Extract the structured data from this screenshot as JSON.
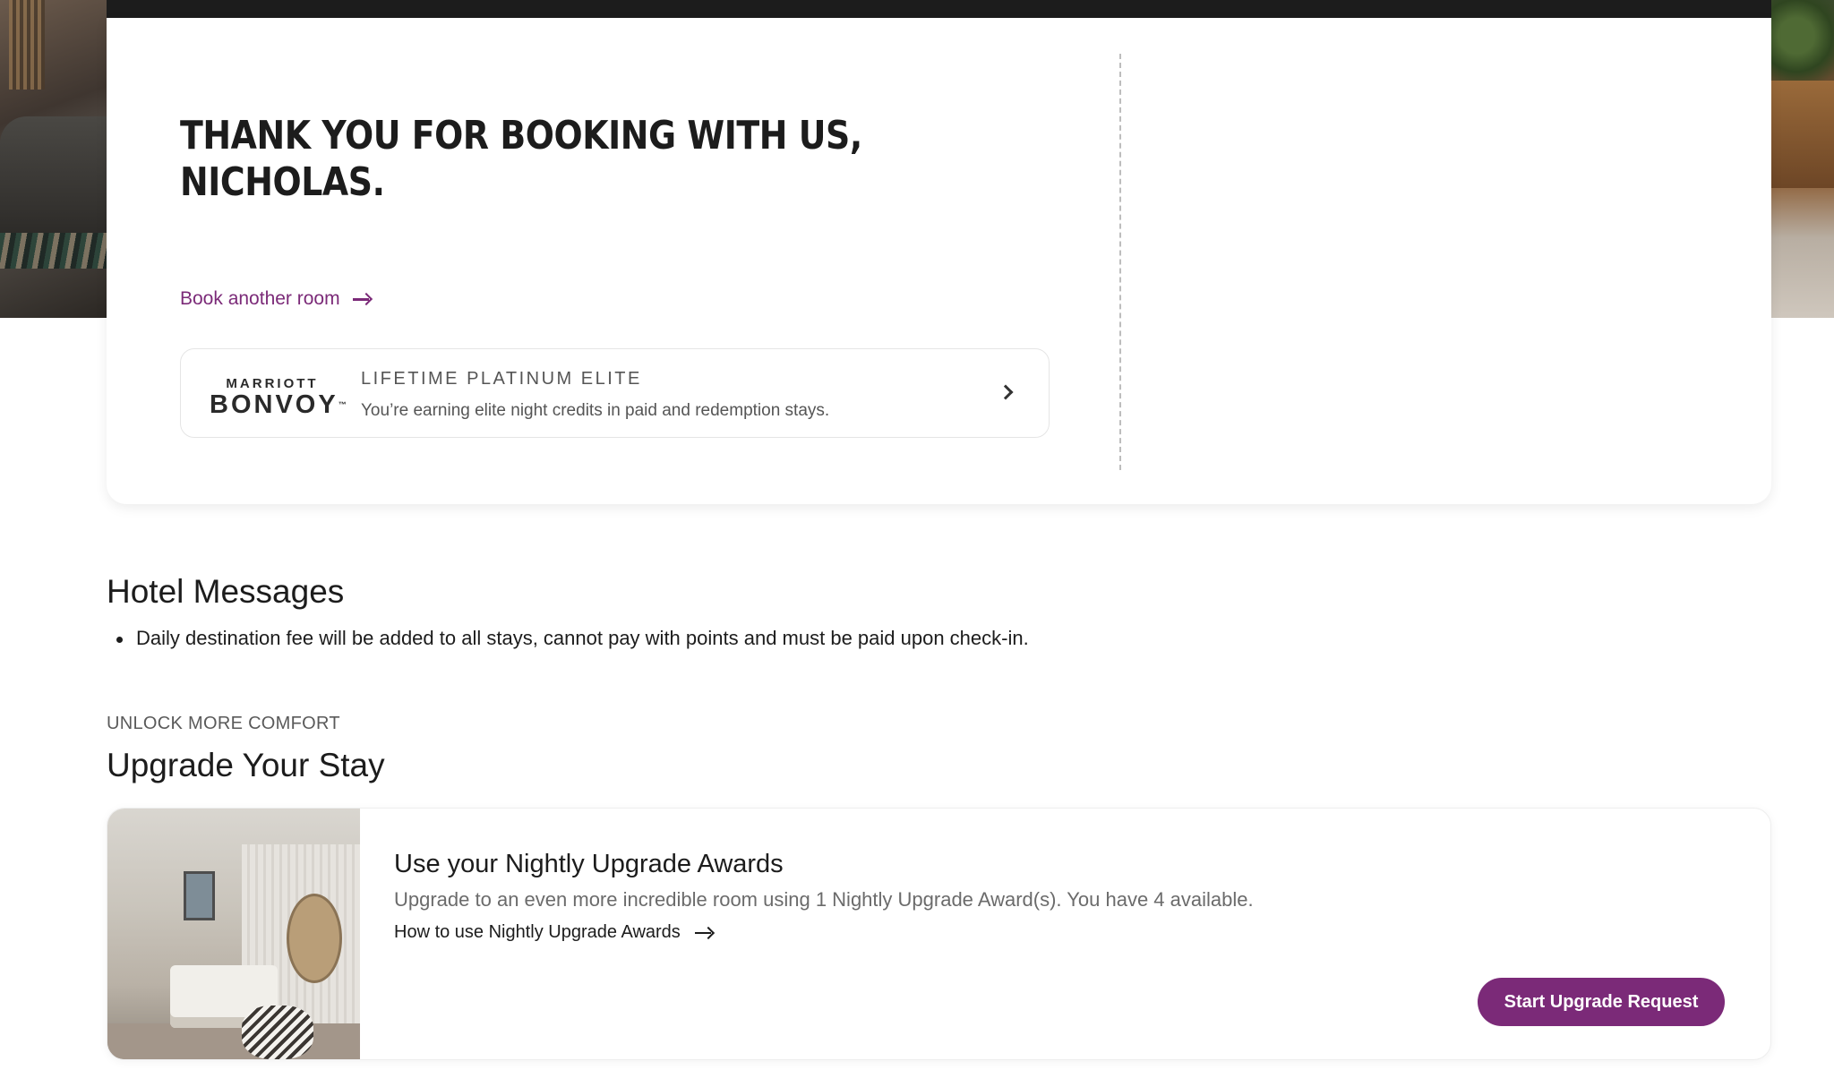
{
  "confirmation": {
    "title": "THANK YOU FOR BOOKING WITH US, NICHOLAS.",
    "book_another_label": "Book another room"
  },
  "loyalty": {
    "logo_top": "MARRIOTT",
    "logo_main": "BONVOY",
    "logo_tm": "™",
    "tier": "LIFETIME PLATINUM ELITE",
    "description": "You’re earning elite night credits in paid and redemption stays."
  },
  "hotel_messages": {
    "title": "Hotel Messages",
    "items": [
      "Daily destination fee will be added to all stays, cannot pay with points and must be paid upon check-in."
    ]
  },
  "upgrade": {
    "eyebrow": "UNLOCK MORE COMFORT",
    "title": "Upgrade Your Stay",
    "card_heading": "Use your Nightly Upgrade Awards",
    "card_description": "Upgrade to an even more incredible room using 1 Nightly Upgrade Award(s). You have 4 available.",
    "howto_label": "How to use Nightly Upgrade Awards",
    "button_label": "Start Upgrade Request"
  },
  "colors": {
    "accent": "#7b2a78",
    "text": "#1c1c1c",
    "muted": "#6b6b6b"
  },
  "icons": [
    "arrow-right-icon",
    "chevron-right-icon"
  ]
}
